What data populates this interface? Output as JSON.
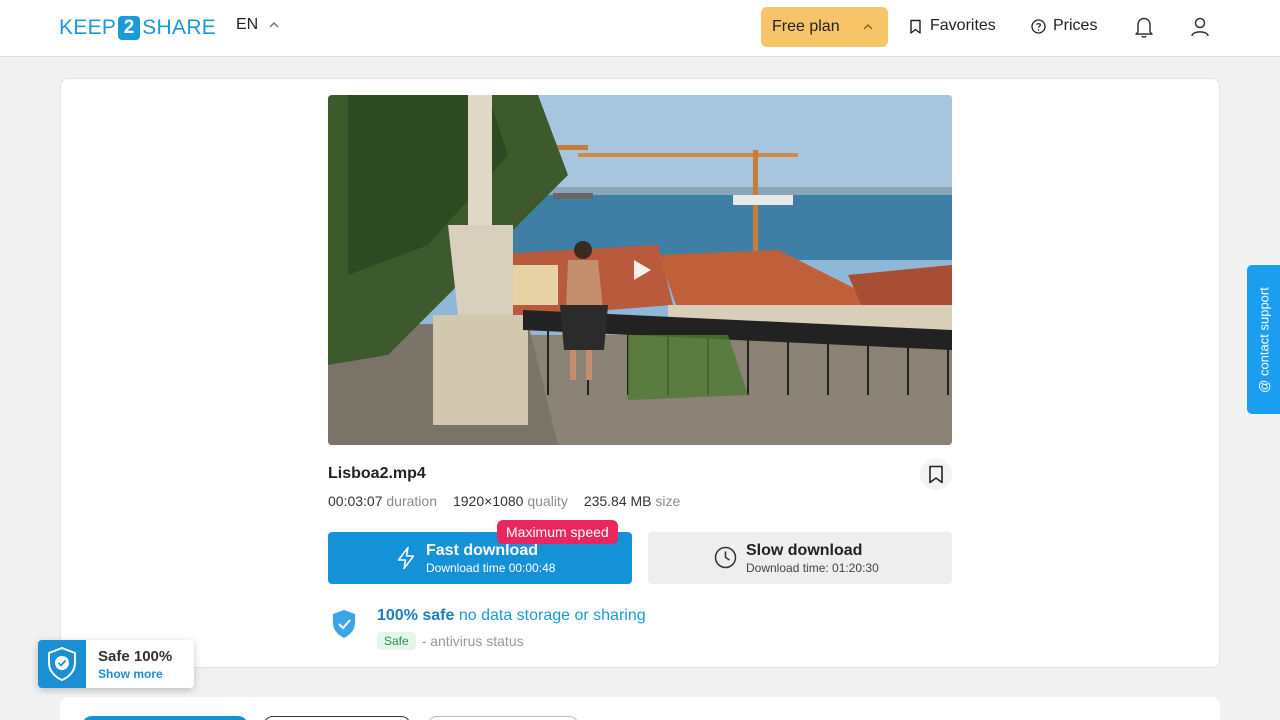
{
  "header": {
    "logo": {
      "left": "KEEP",
      "middle": "2",
      "right": "SHARE"
    },
    "language": "EN",
    "plan_label": "Free plan",
    "favorites_label": "Favorites",
    "prices_label": "Prices"
  },
  "file": {
    "name": "Lisboa2.mp4",
    "duration_value": "00:03:07",
    "duration_label": "duration",
    "quality_value": "1920×1080",
    "quality_label": "quality",
    "size_value": "235.84 MB",
    "size_label": "size"
  },
  "downloads": {
    "fast_title": "Fast download",
    "fast_subtitle": "Download time 00:00:48",
    "fast_badge": "Maximum speed",
    "slow_title": "Slow download",
    "slow_subtitle": "Download time: 01:20:30"
  },
  "safety": {
    "strong": "100% safe",
    "rest": "no data storage or sharing",
    "status_badge": "Safe",
    "status_text": "- antivirus status"
  },
  "safe_widget": {
    "title": "Safe 100%",
    "link": "Show more"
  },
  "support_tab": "@ contact support",
  "colors": {
    "brand": "#1a9ad9",
    "fast_button": "#1591d8",
    "plan_button": "#f7c468",
    "max_badge": "#e8275e",
    "support_tab": "#1a9ef0"
  },
  "icons": [
    "chevron-up-icon",
    "bookmark-icon",
    "help-circle-icon",
    "bell-icon",
    "user-icon",
    "play-icon",
    "lightning-icon",
    "clock-icon",
    "shield-check-icon"
  ]
}
